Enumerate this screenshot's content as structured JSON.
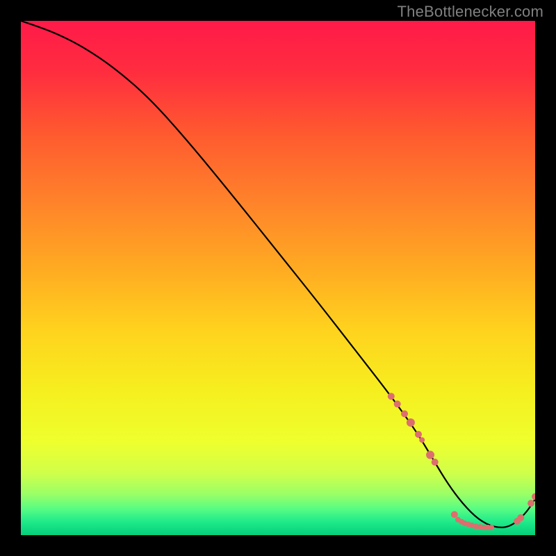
{
  "watermark": "TheBottlenecker.com",
  "colors": {
    "bg": "#000000",
    "curve": "#000000",
    "marker": "#dd6e6e",
    "gradient_stops": [
      {
        "offset": 0.0,
        "color": "#ff1a49"
      },
      {
        "offset": 0.1,
        "color": "#ff2d3f"
      },
      {
        "offset": 0.22,
        "color": "#ff5a2f"
      },
      {
        "offset": 0.35,
        "color": "#ff822a"
      },
      {
        "offset": 0.48,
        "color": "#ffaa22"
      },
      {
        "offset": 0.6,
        "color": "#ffd21e"
      },
      {
        "offset": 0.72,
        "color": "#f6ef1f"
      },
      {
        "offset": 0.82,
        "color": "#eeff2e"
      },
      {
        "offset": 0.88,
        "color": "#cfff4a"
      },
      {
        "offset": 0.92,
        "color": "#9bff66"
      },
      {
        "offset": 0.95,
        "color": "#55fc84"
      },
      {
        "offset": 0.975,
        "color": "#1de989"
      },
      {
        "offset": 1.0,
        "color": "#06cf7a"
      }
    ]
  },
  "chart_data": {
    "type": "line",
    "title": "",
    "xlabel": "",
    "ylabel": "",
    "xlim": [
      0,
      100
    ],
    "ylim": [
      0,
      100
    ],
    "series": [
      {
        "name": "bottleneck-curve",
        "x": [
          0,
          3,
          7,
          12,
          18,
          25,
          33,
          42,
          50,
          58,
          65,
          72,
          77,
          80,
          83,
          86,
          89,
          92,
          95,
          98,
          100
        ],
        "y": [
          100,
          99,
          97.5,
          95,
          91,
          85,
          76,
          65,
          55,
          45,
          36,
          27,
          20,
          15,
          10,
          6,
          3,
          1.5,
          1.5,
          4,
          7
        ]
      }
    ],
    "markers": [
      {
        "x": 72.0,
        "y": 27.0,
        "r": 5
      },
      {
        "x": 73.2,
        "y": 25.5,
        "r": 5
      },
      {
        "x": 74.6,
        "y": 23.6,
        "r": 5
      },
      {
        "x": 75.8,
        "y": 21.9,
        "r": 6
      },
      {
        "x": 77.3,
        "y": 19.6,
        "r": 5
      },
      {
        "x": 78.0,
        "y": 18.5,
        "r": 4
      },
      {
        "x": 79.6,
        "y": 15.6,
        "r": 6
      },
      {
        "x": 80.5,
        "y": 14.2,
        "r": 5
      },
      {
        "x": 84.3,
        "y": 4.0,
        "r": 5
      },
      {
        "x": 85.0,
        "y": 3.0,
        "r": 4
      },
      {
        "x": 85.7,
        "y": 2.6,
        "r": 4
      },
      {
        "x": 86.3,
        "y": 2.3,
        "r": 4
      },
      {
        "x": 87.0,
        "y": 2.1,
        "r": 4
      },
      {
        "x": 87.7,
        "y": 1.9,
        "r": 4
      },
      {
        "x": 88.5,
        "y": 1.7,
        "r": 4
      },
      {
        "x": 89.3,
        "y": 1.6,
        "r": 4
      },
      {
        "x": 90.0,
        "y": 1.5,
        "r": 4
      },
      {
        "x": 90.8,
        "y": 1.5,
        "r": 4
      },
      {
        "x": 91.5,
        "y": 1.5,
        "r": 4
      },
      {
        "x": 96.5,
        "y": 2.7,
        "r": 5
      },
      {
        "x": 97.2,
        "y": 3.4,
        "r": 5
      },
      {
        "x": 99.2,
        "y": 6.2,
        "r": 5
      },
      {
        "x": 100.0,
        "y": 7.5,
        "r": 5
      }
    ]
  }
}
